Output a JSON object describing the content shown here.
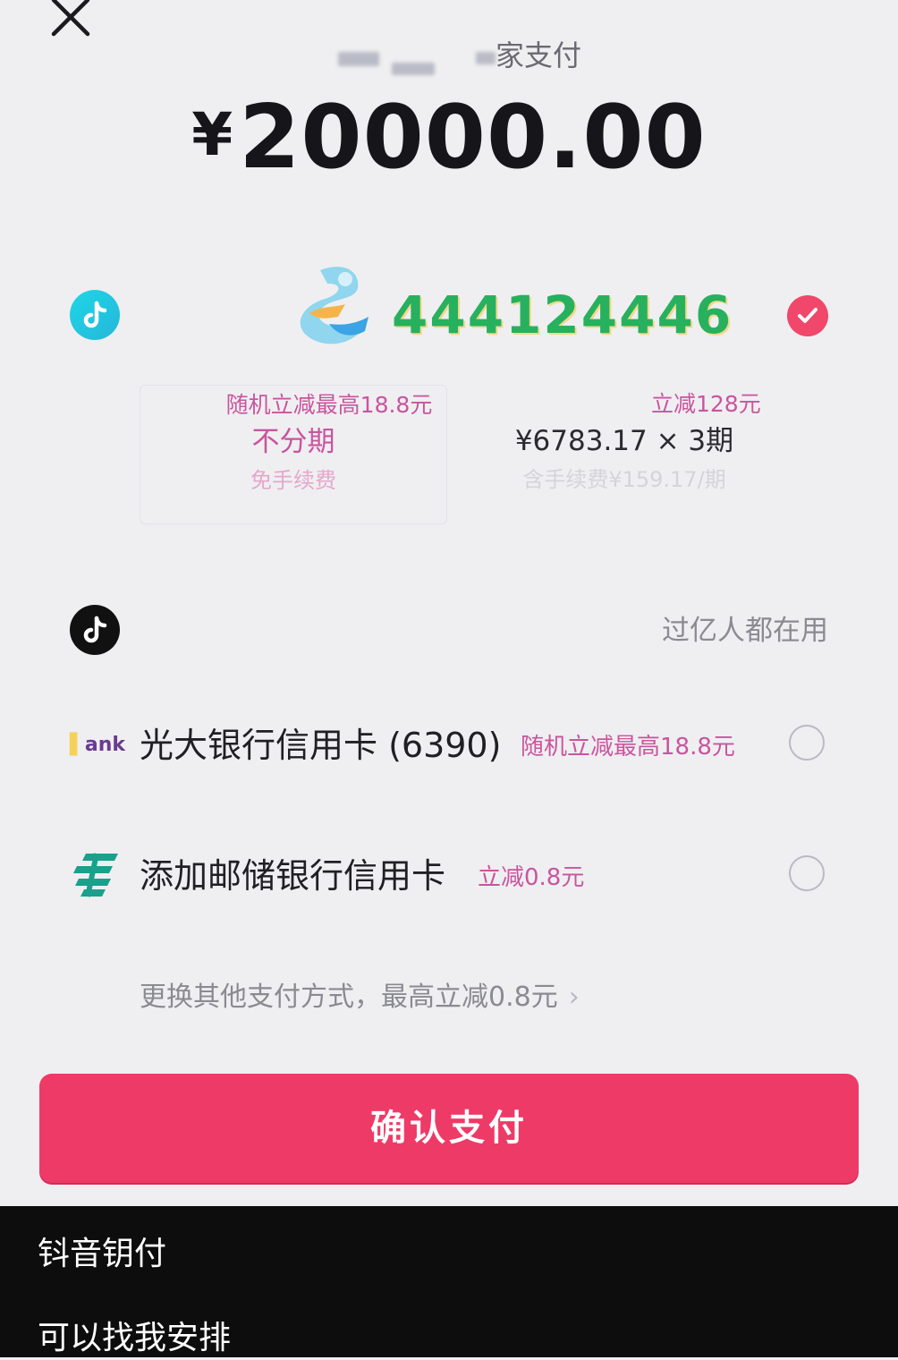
{
  "header": {
    "close_icon": "close-icon",
    "merchant_suffix": "家支付",
    "currency_symbol": "¥",
    "amount": "20000.00"
  },
  "monthly_pay": {
    "icon": "tiktok-icon",
    "overlay_number": "444124446",
    "selected": true,
    "plans": [
      {
        "promo": "随机立减最高18.8元",
        "main": "不分期",
        "sub": "免手续费"
      },
      {
        "promo": "立减128元",
        "main": "¥6783.17 × 3期",
        "sub": "含手续费¥159.17/期"
      }
    ]
  },
  "douyin_pay": {
    "icon": "tiktok-icon",
    "users_text": "过亿人都在用",
    "methods": [
      {
        "logo_text": "ank",
        "label": "光大银行信用卡 (6390)",
        "promo": "随机立减最高18.8元",
        "selected": false
      },
      {
        "icon": "postal-bank-icon",
        "label": "添加邮储银行信用卡",
        "promo": "立减0.8元",
        "selected": false
      }
    ],
    "other_methods": "更换其他支付方式，最高立减0.8元",
    "chevron": "›"
  },
  "confirm_button": "确认支付",
  "captions": [
    "钭音钥付",
    "可以找我安排"
  ],
  "colors": {
    "accent": "#ee3a67",
    "promo": "#c9559e",
    "overlay_number": "#27b15f",
    "tiktok_cyan": "#1fd6e8"
  }
}
